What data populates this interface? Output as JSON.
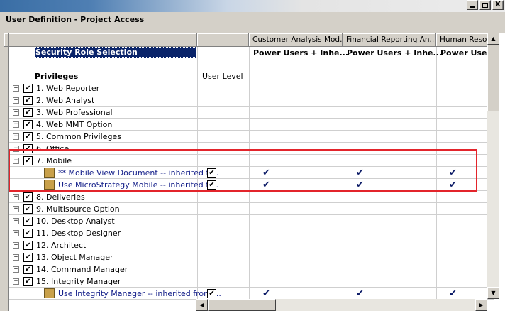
{
  "window": {
    "min_label": "_",
    "close_label": "X",
    "dialog_title": "User Definition - Project Access"
  },
  "columns": {
    "customer": "Customer Analysis Mod...",
    "financial": "Financial Reporting An...",
    "human": "Human Resou"
  },
  "header_rows": {
    "security_role_selection": "Security Role Selection",
    "customer_role": "Power Users + Inhe...",
    "financial_role": "Power Users + Inhe...",
    "human_role": "Power Users",
    "privileges": "Privileges",
    "user_level": "User Level"
  },
  "rows": [
    {
      "label": "1. Web Reporter",
      "expander": "+"
    },
    {
      "label": "2. Web Analyst",
      "expander": "+"
    },
    {
      "label": "3. Web Professional",
      "expander": "+"
    },
    {
      "label": "4. Web MMT Option",
      "expander": "+"
    },
    {
      "label": "5. Common Privileges",
      "expander": "+"
    },
    {
      "label": "6. Office",
      "expander": "+"
    },
    {
      "label": "7. Mobile",
      "expander": "−"
    },
    {
      "label": "** Mobile View Document -- inherited fr...",
      "sub": true
    },
    {
      "label": "Use MicroStrategy Mobile -- inherited fr...",
      "sub": true
    },
    {
      "label": "8. Deliveries",
      "expander": "+"
    },
    {
      "label": "9. Multisource Option",
      "expander": "+"
    },
    {
      "label": "10. Desktop Analyst",
      "expander": "+"
    },
    {
      "label": "11. Desktop Designer",
      "expander": "+"
    },
    {
      "label": "12. Architect",
      "expander": "+"
    },
    {
      "label": "13. Object Manager",
      "expander": "+"
    },
    {
      "label": "14. Command Manager",
      "expander": "+"
    },
    {
      "label": "15. Integrity Manager",
      "expander": "−"
    },
    {
      "label": "Use Integrity Manager -- inherited from ...",
      "sub": true
    }
  ],
  "glyphs": {
    "checkbox_checked": "✔",
    "role_check": "✔"
  },
  "colors": {
    "highlight_border": "#e3242b",
    "selection_bg": "#0a246a",
    "sub_text": "#15208a"
  },
  "scroll": {
    "up": "▲",
    "down": "▼",
    "left": "◀",
    "right": "▶"
  }
}
